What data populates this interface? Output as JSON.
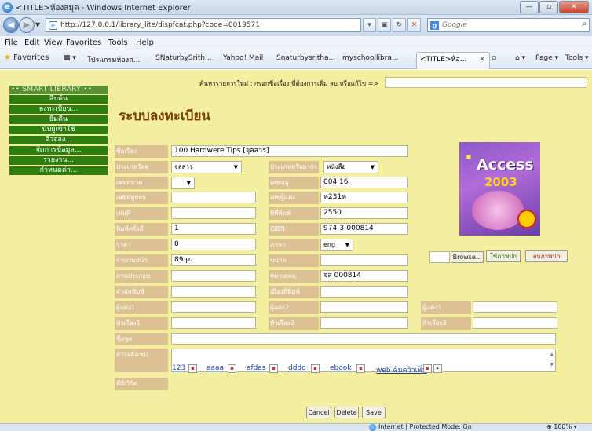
{
  "window": {
    "title": "<TITLE>ห้องสมุด - Windows Internet Explorer"
  },
  "address": {
    "url": "http://127.0.0.1/library_lite/dispfcat.php?code=0019571",
    "search_placeholder": "Google"
  },
  "menu": [
    "File",
    "Edit",
    "View",
    "Favorites",
    "Tools",
    "Help"
  ],
  "favorites": {
    "label": "Favorites",
    "items": [
      "โปรแกรมห้องส...",
      "SNaturbySrith...",
      "Yahoo! Mail",
      "Snaturbysritha...",
      "myschoollibra..."
    ],
    "active_tab": "<TITLE>ห้อ..."
  },
  "commands": {
    "page": "Page ▾",
    "tools": "Tools ▾"
  },
  "sidebar": {
    "header": "•• SMART LIBRARY ••",
    "items": [
      "สืบค้น",
      "ลงทะเบียน...",
      "ยืมคืน",
      "นับผู้เข้าใช้",
      "คิวจอง...",
      "จัดการข้อมูล...",
      "รายงาน...",
      "กำหนดค่า..."
    ]
  },
  "search_prompt": "ค้นหารายการใหม่ : กรอกชื่อเรื่อง ที่ต้องการเพิ่ม ลบ หรือแก้ไข =>",
  "page_title": "ระบบลงทะเบียน",
  "form": {
    "labels": {
      "title": "ชื่อเรื่อง",
      "material_type": "ประเภทวัสดุ",
      "category": "เลขหมวด",
      "sub_no": "เลขหมู่ย่อย",
      "volume": "เล่มที่",
      "edition": "พิมพ์ครั้งที่",
      "price": "ราคา",
      "pages": "จำนวนหน้า",
      "components": "ส่วนประกอบ",
      "publisher": "สำนักพิมพ์",
      "author1": "ผู้แต่ง1",
      "subject1": "หัวเรื่อง1",
      "series": "ชื่อชุด",
      "abstract": "สาระสังเขป",
      "keywords": "คีย์เวิร์ด",
      "resource_type": "ประเภททรัพยากร",
      "call_no": "เลขหมู่",
      "author_mark": "เลขผู้แต่ง",
      "year": "ปีที่พิมพ์",
      "isbn": "ISBN",
      "language": "ภาษา",
      "size": "ขนาด",
      "note": "หมายเหตุ",
      "place": "เมืองที่พิมพ์",
      "author2": "ผู้แต่ง2",
      "subject2": "หัวเรื่อง2",
      "author3": "ผู้แต่ง3",
      "subject3": "หัวเรื่อง3"
    },
    "values": {
      "title": "100 Hardwere Tips [จุลสาร]",
      "material_type": "จุลสาร",
      "category": "",
      "call_no": "004.16",
      "author_mark": "ห231ห",
      "year": "2550",
      "isbn": "974-3-000814",
      "edition": "1",
      "price": "0",
      "language": "eng",
      "pages": "89 p.",
      "note": "จส 000814",
      "resource_type": "หนังสือ"
    }
  },
  "cover": {
    "label_top": "Access",
    "year": "2003"
  },
  "cover_buttons": {
    "browse": "Browse...",
    "use": "ใช้ภาพปก",
    "delete": "ลบภาพปก"
  },
  "keywords": [
    "123",
    "aaaa",
    "afdas",
    "dddd",
    "ebook",
    "web ค้นคว้าเพิ่ม"
  ],
  "actions": {
    "cancel": "Cancel",
    "delete": "Delete",
    "save": "Save"
  },
  "status": {
    "text": "Internet | Protected Mode: On",
    "zoom": "100%"
  }
}
